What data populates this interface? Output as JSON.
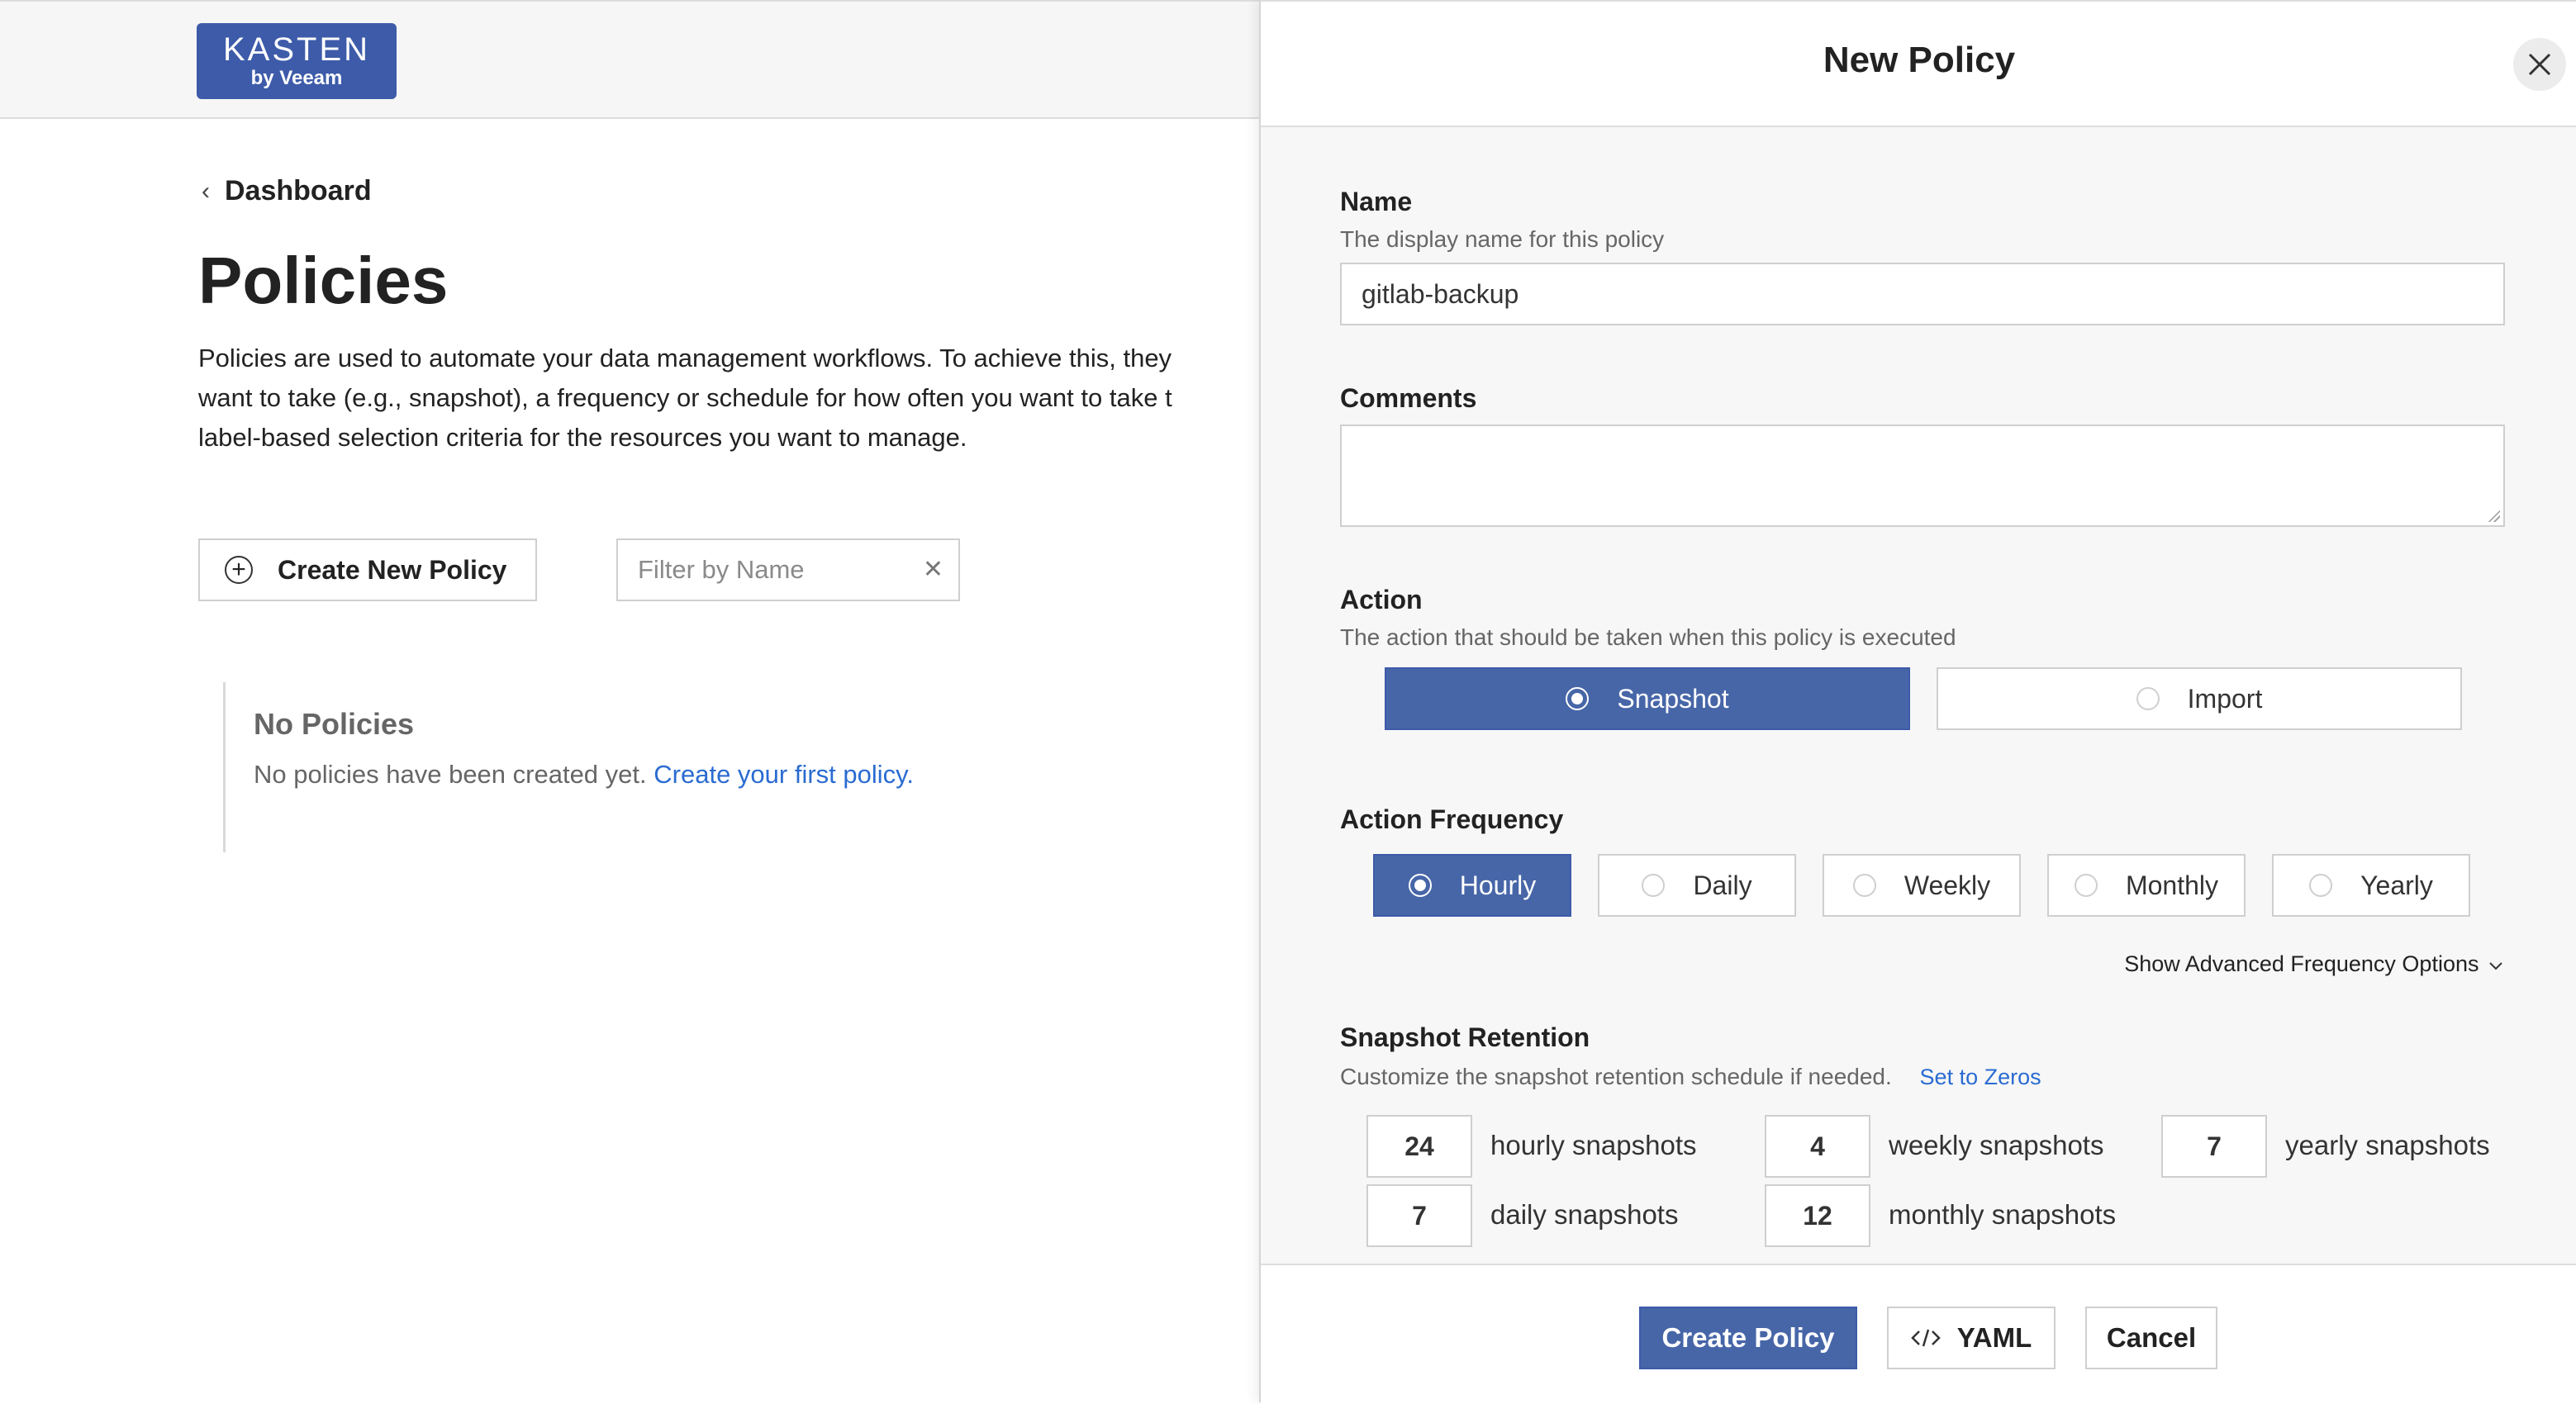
{
  "header": {
    "logo_brand": "KASTEN",
    "logo_sub": "by Veeam"
  },
  "breadcrumb": {
    "label": "Dashboard"
  },
  "page": {
    "title": "Policies",
    "description_lines": [
      "Policies are used to automate your data management workflows. To achieve this, they",
      "want to take (e.g., snapshot), a frequency or schedule for how often you want to take t",
      "label-based selection criteria for the resources you want to manage."
    ]
  },
  "toolbar": {
    "create_label": "Create New Policy",
    "filter_placeholder": "Filter by Name",
    "filter_value": ""
  },
  "empty_state": {
    "title": "No Policies",
    "message": "No policies have been created yet.",
    "link": "Create your first policy."
  },
  "panel": {
    "title": "New Policy",
    "name": {
      "label": "Name",
      "help": "The display name for this policy",
      "value": "gitlab-backup"
    },
    "comments": {
      "label": "Comments",
      "value": ""
    },
    "action": {
      "label": "Action",
      "help": "The action that should be taken when this policy is executed",
      "options": [
        "Snapshot",
        "Import"
      ],
      "selected": "Snapshot"
    },
    "frequency": {
      "label": "Action Frequency",
      "options": [
        "Hourly",
        "Daily",
        "Weekly",
        "Monthly",
        "Yearly"
      ],
      "selected": "Hourly",
      "advanced_link": "Show Advanced Frequency Options"
    },
    "retention": {
      "label": "Snapshot Retention",
      "help": "Customize the snapshot retention schedule if needed.",
      "set_zeros": "Set to Zeros",
      "items": [
        {
          "value": "24",
          "label": "hourly snapshots"
        },
        {
          "value": "4",
          "label": "weekly snapshots"
        },
        {
          "value": "7",
          "label": "yearly snapshots"
        },
        {
          "value": "7",
          "label": "daily snapshots"
        },
        {
          "value": "12",
          "label": "monthly snapshots"
        }
      ]
    },
    "footer": {
      "create_label": "Create Policy",
      "yaml_label": "YAML",
      "cancel_label": "Cancel"
    }
  },
  "colors": {
    "primary": "#4766a8",
    "link": "#2a6bd1"
  }
}
